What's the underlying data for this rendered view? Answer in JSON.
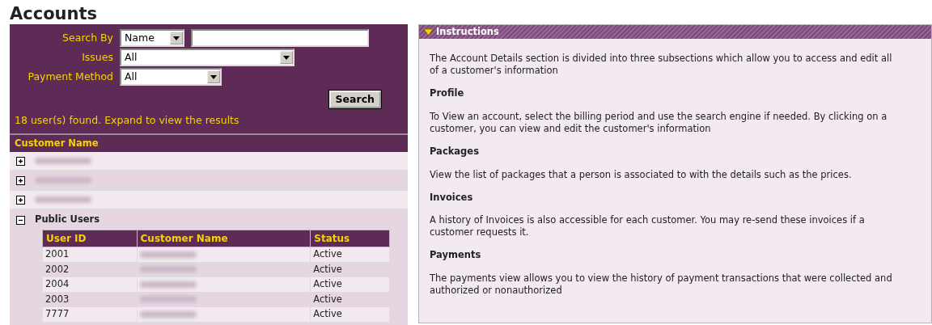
{
  "title": "Accounts",
  "search": {
    "fields": [
      {
        "label": "Search By",
        "kind": "select-text",
        "value": "Name"
      },
      {
        "label": "Issues",
        "kind": "select-wide",
        "value": "All"
      },
      {
        "label": "Payment Method",
        "kind": "select",
        "value": "All"
      }
    ],
    "button": "Search",
    "result_text": "18 user(s) found. Expand to view the results"
  },
  "results": {
    "column": "Customer Name",
    "groups": [
      {
        "expanded": false,
        "name_redacted": true
      },
      {
        "expanded": false,
        "name_redacted": true
      },
      {
        "expanded": false,
        "name_redacted": true
      },
      {
        "expanded": true,
        "name": "Public Users",
        "columns": [
          "User ID",
          "Customer Name",
          "Status"
        ],
        "rows": [
          {
            "user_id": "2001",
            "name_redacted": true,
            "status": "Active"
          },
          {
            "user_id": "2002",
            "name_redacted": true,
            "status": "Active"
          },
          {
            "user_id": "2004",
            "name_redacted": true,
            "status": "Active"
          },
          {
            "user_id": "2003",
            "name_redacted": true,
            "status": "Active"
          },
          {
            "user_id": "7777",
            "name_redacted": true,
            "status": "Active"
          }
        ]
      }
    ]
  },
  "instructions": {
    "title": "Instructions",
    "expanded": true,
    "blocks": [
      {
        "kind": "text",
        "text": "The Account Details section is divided into three subsections which allow you to access and edit all of a customer's information"
      },
      {
        "kind": "heading",
        "text": "Profile"
      },
      {
        "kind": "text",
        "text": "To View an account, select the billing period and use the search engine if needed. By clicking on a customer, you can view and edit the customer's information"
      },
      {
        "kind": "heading",
        "text": "Packages"
      },
      {
        "kind": "text",
        "text": "View the list of packages that a person is associated to with the details such as the prices."
      },
      {
        "kind": "heading",
        "text": "Invoices"
      },
      {
        "kind": "text",
        "text": "A history of Invoices is also accessible for each customer. You may re-send these invoices if a customer requests it."
      },
      {
        "kind": "heading",
        "text": "Payments"
      },
      {
        "kind": "text",
        "text": "The payments view allows you to view the history of payment transactions that were collected and authorized or nonauthorized"
      }
    ]
  }
}
